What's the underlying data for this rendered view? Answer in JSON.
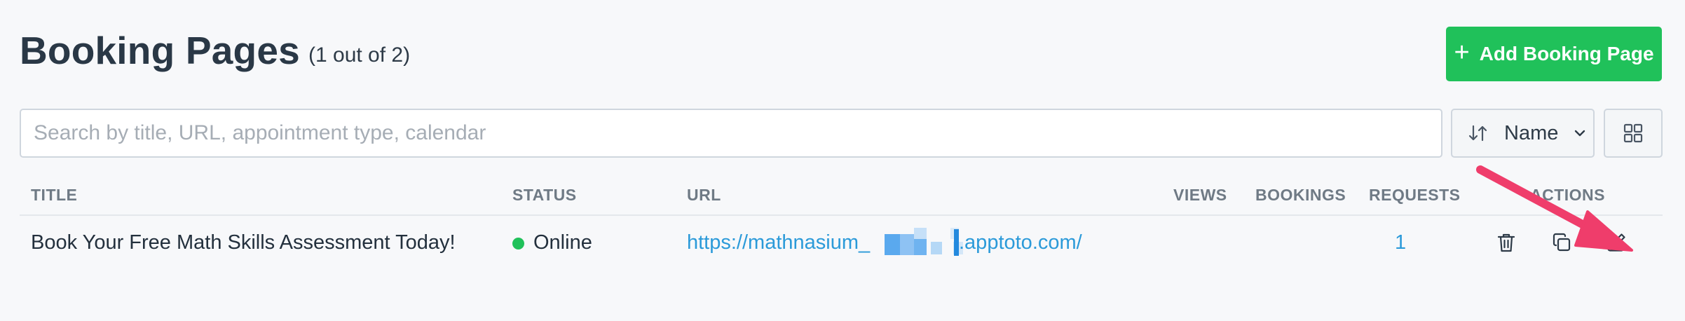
{
  "header": {
    "title": "Booking Pages",
    "count": "(1 out of 2)",
    "add_button_label": "Add Booking Page"
  },
  "toolbar": {
    "search_placeholder": "Search by title, URL, appointment type, calendar",
    "search_value": "",
    "sort_label": "Name",
    "sort_icon": "sort-arrows-icon",
    "view_toggle_icon": "grid-view-icon"
  },
  "table": {
    "columns": [
      "TITLE",
      "STATUS",
      "URL",
      "VIEWS",
      "BOOKINGS",
      "REQUESTS",
      "ACTIONS"
    ],
    "rows": [
      {
        "title": "Book Your Free Math Skills Assessment Today!",
        "status": "Online",
        "url_prefix": "https://mathnasium_",
        "url_suffix": ".apptoto.com/",
        "views": "",
        "bookings": "",
        "requests": "1",
        "actions": [
          "trash-icon",
          "copy-icon",
          "edit-icon"
        ]
      }
    ]
  },
  "colors": {
    "primary_green": "#20c15a",
    "link_blue": "#2b9ad9",
    "annotation_arrow": "#ef3d6b"
  }
}
